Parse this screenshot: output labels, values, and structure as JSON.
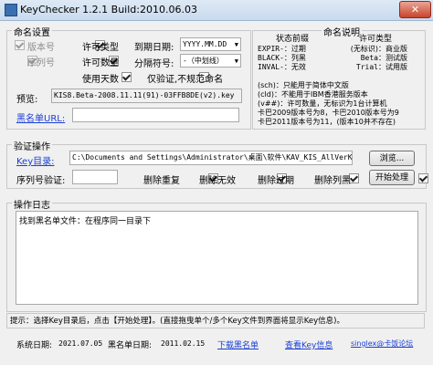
{
  "window": {
    "title": "KeyChecker 1.2.1 Build:2010.06.03",
    "close_glyph": "✕"
  },
  "naming": {
    "group_label": "命名设置",
    "chk_version": "版本号",
    "chk_serial": "序列号",
    "chk_license_type": "许可类型",
    "chk_license_count": "许可数量",
    "chk_use_days": "使用天数",
    "expiry_label": "到期日期:",
    "expiry_value": "YYYY.MM.DD",
    "separator_label": "分隔符号:",
    "separator_value": "-（中划线）",
    "verify_only": "仅验证,不规范命名",
    "preview_label": "预览:",
    "preview_value": "KIS8.Beta-2008.11.11(91)-03FFB8DE(v2).key",
    "blacklist_url_label": "黑名单URL:",
    "blacklist_url_value": ""
  },
  "status_help": {
    "header": "状态前缀",
    "lines": [
      "EXPIR-：过期",
      "BLACK-：列黑",
      "INVAL-：无效"
    ]
  },
  "naming_help": {
    "header": "命名说明",
    "license_header": "许可类型",
    "rows": [
      [
        "(无标识)",
        "：",
        "商业版"
      ],
      [
        "Beta",
        "：",
        "测试版"
      ],
      [
        "Trial",
        "：",
        "试用版"
      ]
    ],
    "notes": [
      "(sch)：只能用于简体中文版",
      "(cld)：不能用于IBM香港服务版本",
      "(v##)：许可数量，无标识为1台计算机",
      "卡巴2009版本号为8，卡巴2010版本号为9",
      "卡巴2011版本号为11，(版本10并不存在)"
    ]
  },
  "verify": {
    "group_label": "验证操作",
    "key_dir_label": "Key目录:",
    "key_dir_value": "C:\\Documents and Settings\\Administrator\\桌面\\软件\\KAV_KIS_AllVerKey",
    "browse": "浏览...",
    "serial_label": "序列号验证:",
    "serial_value": "",
    "chk_dup": "删除重复",
    "chk_invalid": "删除无效",
    "chk_expired": "删除过期",
    "chk_blacklisted": "删除列黑",
    "start": "开始处理"
  },
  "log": {
    "group_label": "操作日志",
    "text": "找到黑名单文件：在程序同一目录下"
  },
  "hint": "提示：选择Key目录后，点击【开始处理】。(直接拖曳单个/多个Key文件到界面将显示Key信息)。",
  "footer": {
    "sys_date_label": "系统日期:",
    "sys_date": "2021.07.05",
    "blacklist_date_label": "黑名单日期:",
    "blacklist_date": "2011.02.15",
    "download_blacklist": "下载黑名单",
    "view_key_info": "查看Key信息",
    "forum_link": "singlex@卡饭论坛"
  },
  "colors": {
    "link": "#1a3fd6",
    "title_bg": "#c9daee",
    "close": "#c9432c"
  }
}
